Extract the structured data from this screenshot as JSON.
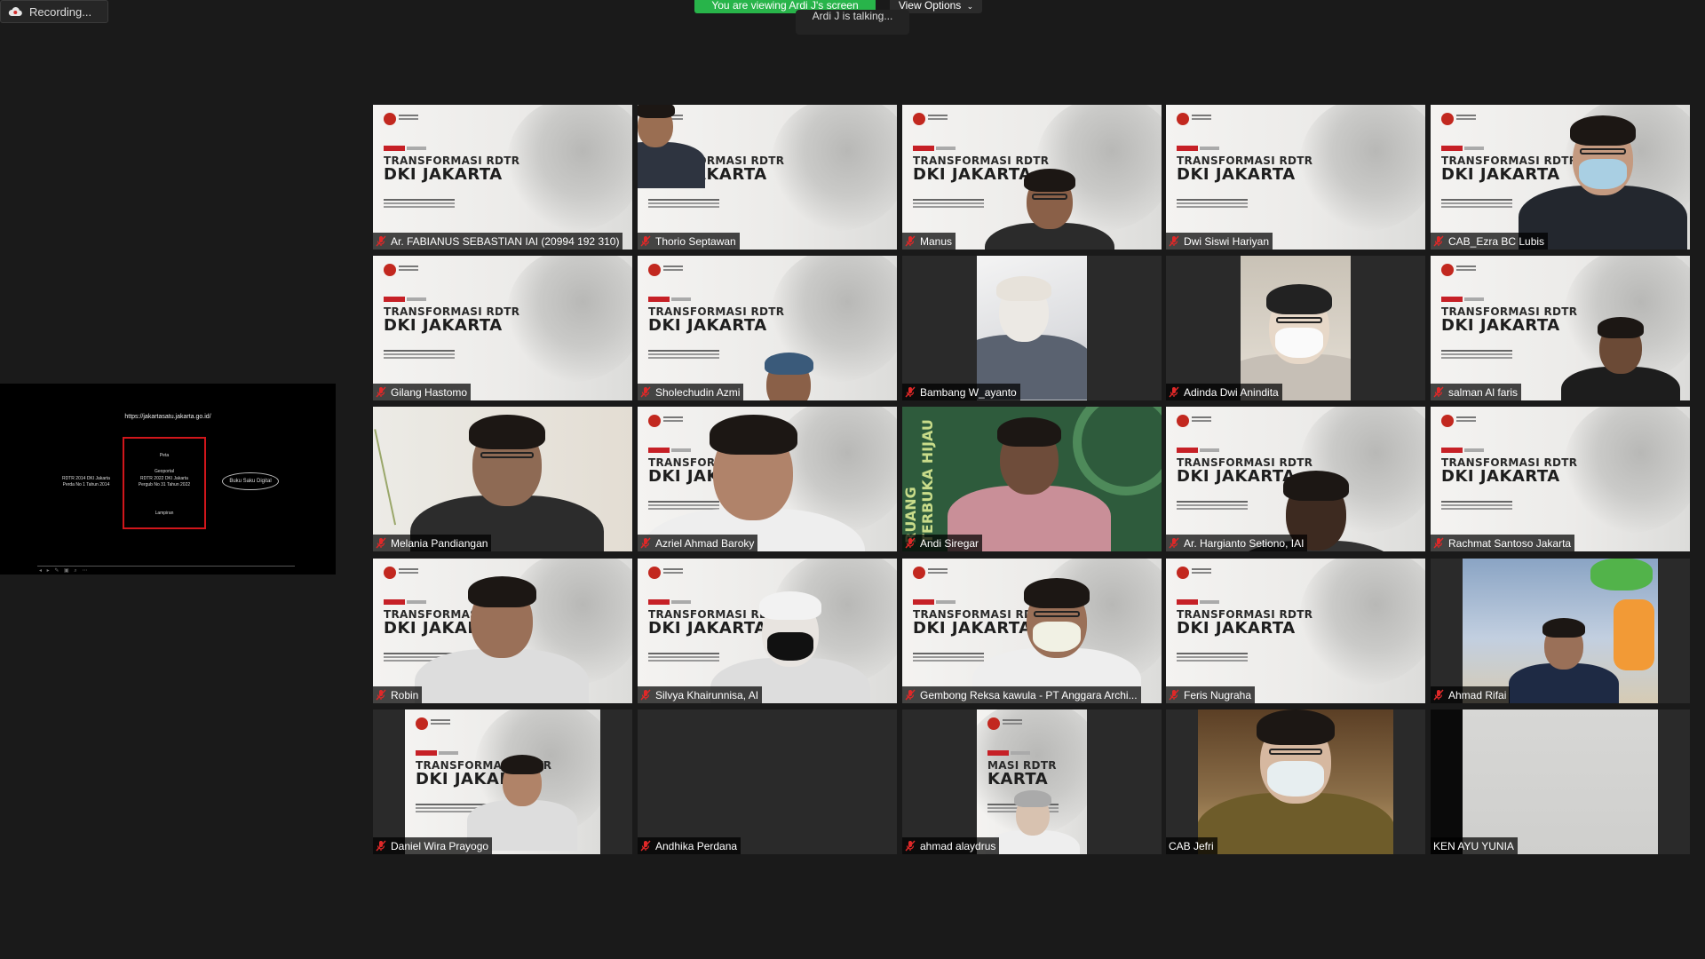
{
  "recording": {
    "label": "Recording..."
  },
  "banner": {
    "viewing": "You are viewing Ardi J's screen",
    "view_options": "View Options"
  },
  "talking": {
    "text": "Ardi J is talking..."
  },
  "shared_screen": {
    "url": "https://jakartasatu.jakarta.go.id/",
    "nodes": {
      "peta": "Peta",
      "rdtr2014": "RDTR 2014 DKI Jakarta",
      "rdtr2014_sub": "Perda No 1 Tahun 2014",
      "geoportal": "Geoportal",
      "rdtr2022": "RDTR 2022 DKI Jakarta",
      "rdtr2022_sub": "Pergub No 31 Tahun 2022",
      "lampiran": "Lampiran",
      "buku_saku": "Buku Saku Digital"
    }
  },
  "slide": {
    "line1": "TRANSFORMASI RDTR",
    "line2": "DKI JAKARTA",
    "line1_partial": "TRANSFORMASI R",
    "line2_partial": "DKI JAKART",
    "line1_crop": "MASI RDTR",
    "line2_crop": "KARTA"
  },
  "green_tile_text": "RUANG TERBUKA HIJAU",
  "colors": {
    "background": "#1a1a1a",
    "tile": "#2a2a2a",
    "banner_green": "#28b44a",
    "mute_red": "#e02828",
    "slide_red": "#c62026"
  },
  "participants": [
    {
      "name": "Ar. FABIANUS SEBASTIAN IAI (20994 192 310)",
      "muted": true
    },
    {
      "name": "Thorio Septawan",
      "muted": true
    },
    {
      "name": "Manus",
      "muted": true
    },
    {
      "name": "Dwi Siswi Hariyan",
      "muted": true
    },
    {
      "name": "CAB_Ezra BC Lubis",
      "muted": true
    },
    {
      "name": "Gilang Hastomo",
      "muted": true
    },
    {
      "name": "Sholechudin Azmi",
      "muted": true
    },
    {
      "name": "Bambang W_ayanto",
      "muted": true
    },
    {
      "name": "Adinda Dwi Anindita",
      "muted": true
    },
    {
      "name": "salman Al faris",
      "muted": true
    },
    {
      "name": "Melania Pandiangan",
      "muted": true
    },
    {
      "name": "Azriel Ahmad Baroky",
      "muted": true
    },
    {
      "name": "Andi Siregar",
      "muted": true
    },
    {
      "name": "Ar. Hargianto Setiono, IAI",
      "muted": true
    },
    {
      "name": "Rachmat Santoso Jakarta",
      "muted": true
    },
    {
      "name": "Robin",
      "muted": true
    },
    {
      "name": "Silvya Khairunnisa, AI",
      "muted": true
    },
    {
      "name": "Gembong Reksa kawula - PT Anggara Archi...",
      "muted": true
    },
    {
      "name": "Feris Nugraha",
      "muted": true
    },
    {
      "name": "Ahmad Rifai",
      "muted": true
    },
    {
      "name": "Daniel Wira Prayogo",
      "muted": true
    },
    {
      "name": "Andhika Perdana",
      "muted": true
    },
    {
      "name": "ahmad alaydrus",
      "muted": true
    },
    {
      "name": "CAB Jefri",
      "muted": false
    },
    {
      "name": "KEN AYU YUNIA",
      "muted": false
    }
  ]
}
